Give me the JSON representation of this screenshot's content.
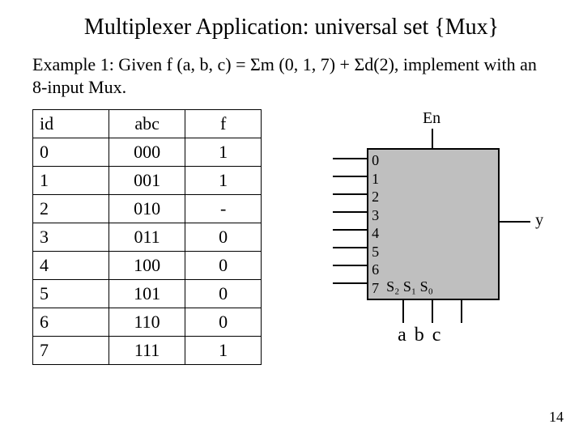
{
  "title": "Multiplexer Application: universal set {Mux}",
  "example": "Example 1: Given f (a, b, c) = Σm (0, 1, 7) + Σd(2), implement with an 8-input Mux.",
  "table": {
    "headers": {
      "id": "id",
      "abc": "abc",
      "f": "f"
    },
    "rows": [
      {
        "id": "0",
        "abc": "000",
        "f": "1"
      },
      {
        "id": "1",
        "abc": "001",
        "f": "1"
      },
      {
        "id": "2",
        "abc": "010",
        "f": "-"
      },
      {
        "id": "3",
        "abc": "011",
        "f": "0"
      },
      {
        "id": "4",
        "abc": "100",
        "f": "0"
      },
      {
        "id": "5",
        "abc": "101",
        "f": "0"
      },
      {
        "id": "6",
        "abc": "110",
        "f": "0"
      },
      {
        "id": "7",
        "abc": "111",
        "f": "1"
      }
    ]
  },
  "mux": {
    "en": "En",
    "inputs": [
      "0",
      "1",
      "2",
      "3",
      "4",
      "5",
      "6",
      "7"
    ],
    "selects": [
      "S₂",
      "S₁",
      "S₀"
    ],
    "select_signals": "a  b  c",
    "output": "y"
  },
  "page": "14"
}
